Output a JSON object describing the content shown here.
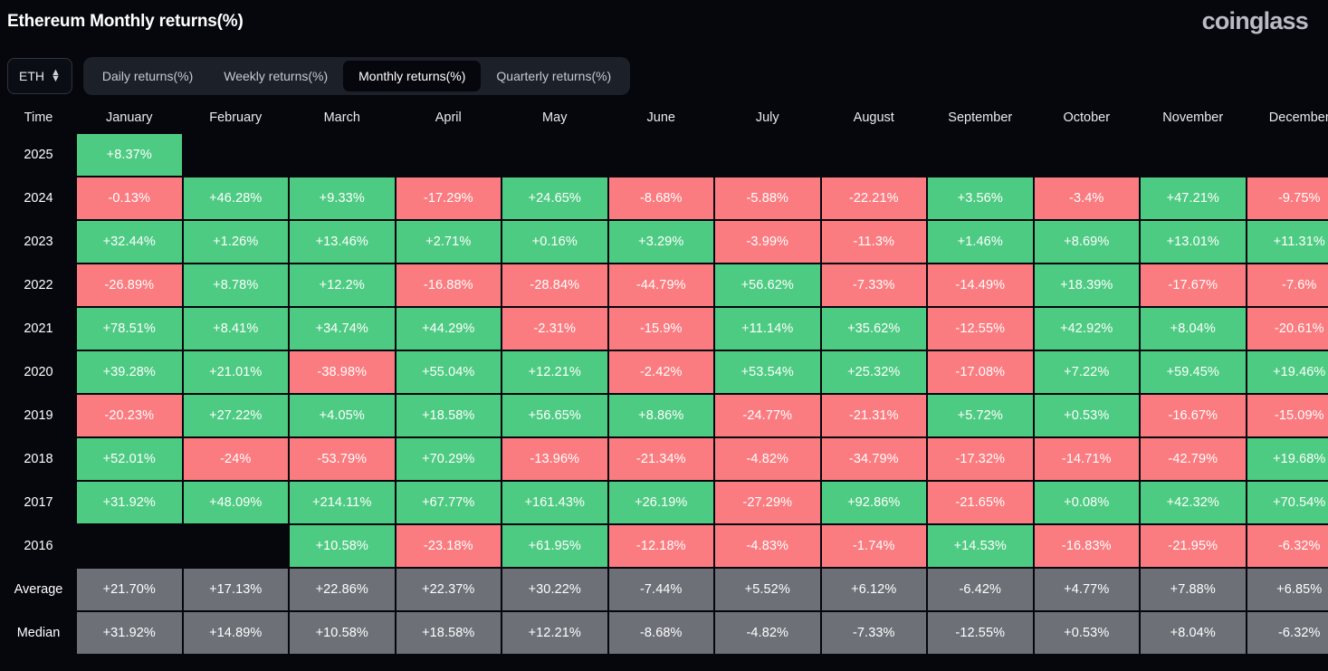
{
  "header": {
    "title": "Ethereum Monthly returns(%)",
    "brand": "coinglass"
  },
  "controls": {
    "symbol": "ETH",
    "symbol_icon": "chevron-up-down-icon",
    "tabs": [
      {
        "label": "Daily returns(%)",
        "active": false
      },
      {
        "label": "Weekly returns(%)",
        "active": false
      },
      {
        "label": "Monthly returns(%)",
        "active": true
      },
      {
        "label": "Quarterly returns(%)",
        "active": false
      }
    ]
  },
  "colors": {
    "positive": "#4ecb82",
    "negative": "#fb7c80",
    "stat_row": "#6d7077",
    "background": "#06060d",
    "tabs_bg": "#1c2029"
  },
  "table": {
    "time_header": "Time",
    "columns": [
      "January",
      "February",
      "March",
      "April",
      "May",
      "June",
      "July",
      "August",
      "September",
      "October",
      "November",
      "December"
    ],
    "rows": [
      {
        "label": "2025",
        "type": "year",
        "values": [
          "+8.37%",
          "",
          "",
          "",
          "",
          "",
          "",
          "",
          "",
          "",
          "",
          ""
        ]
      },
      {
        "label": "2024",
        "type": "year",
        "values": [
          "-0.13%",
          "+46.28%",
          "+9.33%",
          "-17.29%",
          "+24.65%",
          "-8.68%",
          "-5.88%",
          "-22.21%",
          "+3.56%",
          "-3.4%",
          "+47.21%",
          "-9.75%"
        ]
      },
      {
        "label": "2023",
        "type": "year",
        "values": [
          "+32.44%",
          "+1.26%",
          "+13.46%",
          "+2.71%",
          "+0.16%",
          "+3.29%",
          "-3.99%",
          "-11.3%",
          "+1.46%",
          "+8.69%",
          "+13.01%",
          "+11.31%"
        ]
      },
      {
        "label": "2022",
        "type": "year",
        "values": [
          "-26.89%",
          "+8.78%",
          "+12.2%",
          "-16.88%",
          "-28.84%",
          "-44.79%",
          "+56.62%",
          "-7.33%",
          "-14.49%",
          "+18.39%",
          "-17.67%",
          "-7.6%"
        ]
      },
      {
        "label": "2021",
        "type": "year",
        "values": [
          "+78.51%",
          "+8.41%",
          "+34.74%",
          "+44.29%",
          "-2.31%",
          "-15.9%",
          "+11.14%",
          "+35.62%",
          "-12.55%",
          "+42.92%",
          "+8.04%",
          "-20.61%"
        ]
      },
      {
        "label": "2020",
        "type": "year",
        "values": [
          "+39.28%",
          "+21.01%",
          "-38.98%",
          "+55.04%",
          "+12.21%",
          "-2.42%",
          "+53.54%",
          "+25.32%",
          "-17.08%",
          "+7.22%",
          "+59.45%",
          "+19.46%"
        ]
      },
      {
        "label": "2019",
        "type": "year",
        "values": [
          "-20.23%",
          "+27.22%",
          "+4.05%",
          "+18.58%",
          "+56.65%",
          "+8.86%",
          "-24.77%",
          "-21.31%",
          "+5.72%",
          "+0.53%",
          "-16.67%",
          "-15.09%"
        ]
      },
      {
        "label": "2018",
        "type": "year",
        "values": [
          "+52.01%",
          "-24%",
          "-53.79%",
          "+70.29%",
          "-13.96%",
          "-21.34%",
          "-4.82%",
          "-34.79%",
          "-17.32%",
          "-14.71%",
          "-42.79%",
          "+19.68%"
        ]
      },
      {
        "label": "2017",
        "type": "year",
        "values": [
          "+31.92%",
          "+48.09%",
          "+214.11%",
          "+67.77%",
          "+161.43%",
          "+26.19%",
          "-27.29%",
          "+92.86%",
          "-21.65%",
          "+0.08%",
          "+42.32%",
          "+70.54%"
        ]
      },
      {
        "label": "2016",
        "type": "year",
        "values": [
          "",
          "",
          "+10.58%",
          "-23.18%",
          "+61.95%",
          "-12.18%",
          "-4.83%",
          "-1.74%",
          "+14.53%",
          "-16.83%",
          "-21.95%",
          "-6.32%"
        ]
      },
      {
        "label": "Average",
        "type": "stat",
        "values": [
          "+21.70%",
          "+17.13%",
          "+22.86%",
          "+22.37%",
          "+30.22%",
          "-7.44%",
          "+5.52%",
          "+6.12%",
          "-6.42%",
          "+4.77%",
          "+7.88%",
          "+6.85%"
        ]
      },
      {
        "label": "Median",
        "type": "stat",
        "values": [
          "+31.92%",
          "+14.89%",
          "+10.58%",
          "+18.58%",
          "+12.21%",
          "-8.68%",
          "-4.82%",
          "-7.33%",
          "-12.55%",
          "+0.53%",
          "+8.04%",
          "-6.32%"
        ]
      }
    ]
  }
}
